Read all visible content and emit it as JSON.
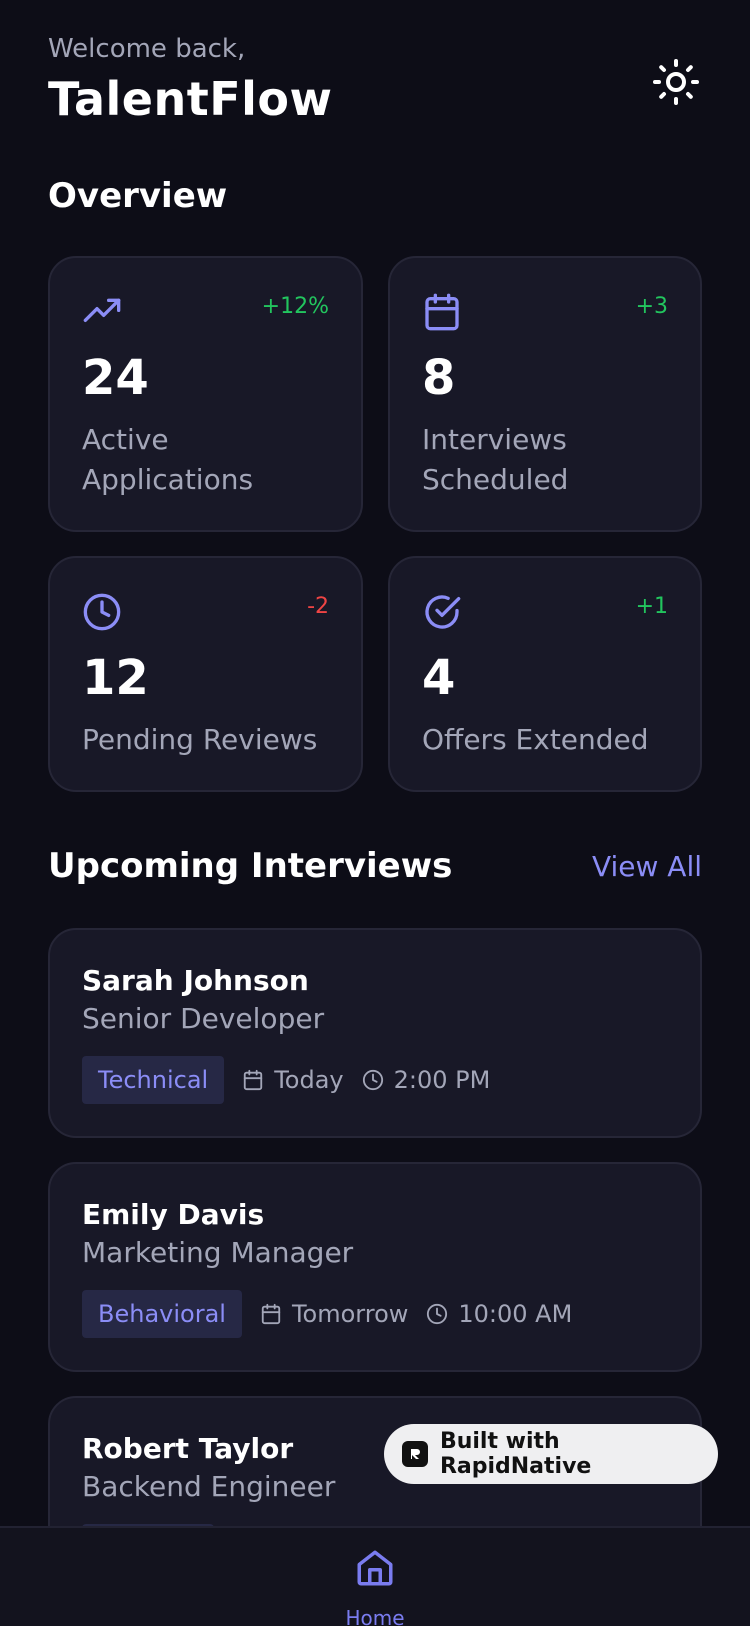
{
  "header": {
    "welcome": "Welcome back,",
    "brand": "TalentFlow",
    "theme_icon": "sun-icon"
  },
  "overview": {
    "title": "Overview",
    "stats": [
      {
        "icon": "trending-up-icon",
        "delta": "+12%",
        "delta_color": "#22c55e",
        "value": "24",
        "label": "Active Applications"
      },
      {
        "icon": "calendar-icon",
        "delta": "+3",
        "delta_color": "#22c55e",
        "value": "8",
        "label": "Interviews Scheduled"
      },
      {
        "icon": "clock-icon",
        "delta": "-2",
        "delta_color": "#ef4444",
        "value": "12",
        "label": "Pending Reviews"
      },
      {
        "icon": "check-circle-icon",
        "delta": "+1",
        "delta_color": "#22c55e",
        "value": "4",
        "label": "Offers Extended"
      }
    ]
  },
  "interviews": {
    "title": "Upcoming Interviews",
    "view_all": "View All",
    "items": [
      {
        "name": "Sarah Johnson",
        "role": "Senior Developer",
        "type": "Technical",
        "date": "Today",
        "time": "2:00 PM"
      },
      {
        "name": "Emily Davis",
        "role": "Marketing Manager",
        "type": "Behavioral",
        "date": "Tomorrow",
        "time": "10:00 AM"
      },
      {
        "name": "Robert Taylor",
        "role": "Backend Engineer"
      }
    ]
  },
  "rapidnative": {
    "label": "Built with RapidNative"
  },
  "tabbar": {
    "home_label": "Home"
  },
  "colors": {
    "accent": "#8b8df6",
    "background": "#0d0d17",
    "card": "#181827",
    "positive": "#22c55e",
    "negative": "#ef4444"
  }
}
